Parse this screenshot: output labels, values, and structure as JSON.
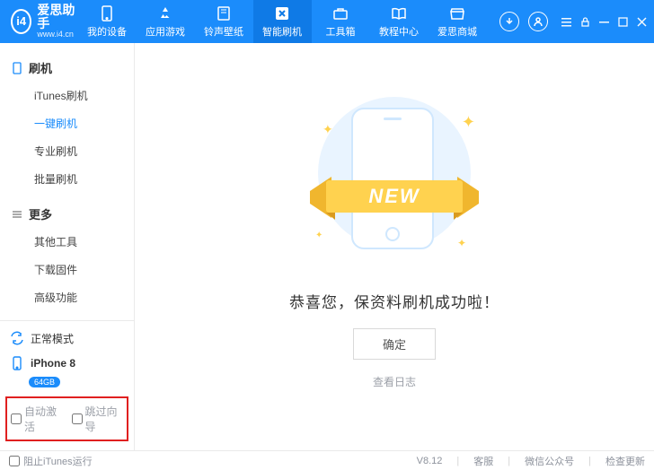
{
  "brand": {
    "logo_text": "i4",
    "name": "爱思助手",
    "site": "www.i4.cn"
  },
  "nav": [
    {
      "label": "我的设备"
    },
    {
      "label": "应用游戏"
    },
    {
      "label": "铃声壁纸"
    },
    {
      "label": "智能刷机"
    },
    {
      "label": "工具箱"
    },
    {
      "label": "教程中心"
    },
    {
      "label": "爱思商城"
    }
  ],
  "sidebar": {
    "section1": {
      "title": "刷机",
      "items": [
        "iTunes刷机",
        "一键刷机",
        "专业刷机",
        "批量刷机"
      ]
    },
    "section2": {
      "title": "更多",
      "items": [
        "其他工具",
        "下载固件",
        "高级功能"
      ]
    }
  },
  "device": {
    "mode": "正常模式",
    "name": "iPhone 8",
    "storage": "64GB"
  },
  "skip": {
    "auto_activate": "自动激活",
    "skip_wizard": "跳过向导"
  },
  "content": {
    "new_badge": "NEW",
    "success_msg": "恭喜您，保资料刷机成功啦！",
    "ok_btn": "确定",
    "log_link": "查看日志"
  },
  "footer": {
    "prevent_itunes": "阻止iTunes运行",
    "version": "V8.12",
    "support": "客服",
    "wechat": "微信公众号",
    "update": "检查更新"
  }
}
